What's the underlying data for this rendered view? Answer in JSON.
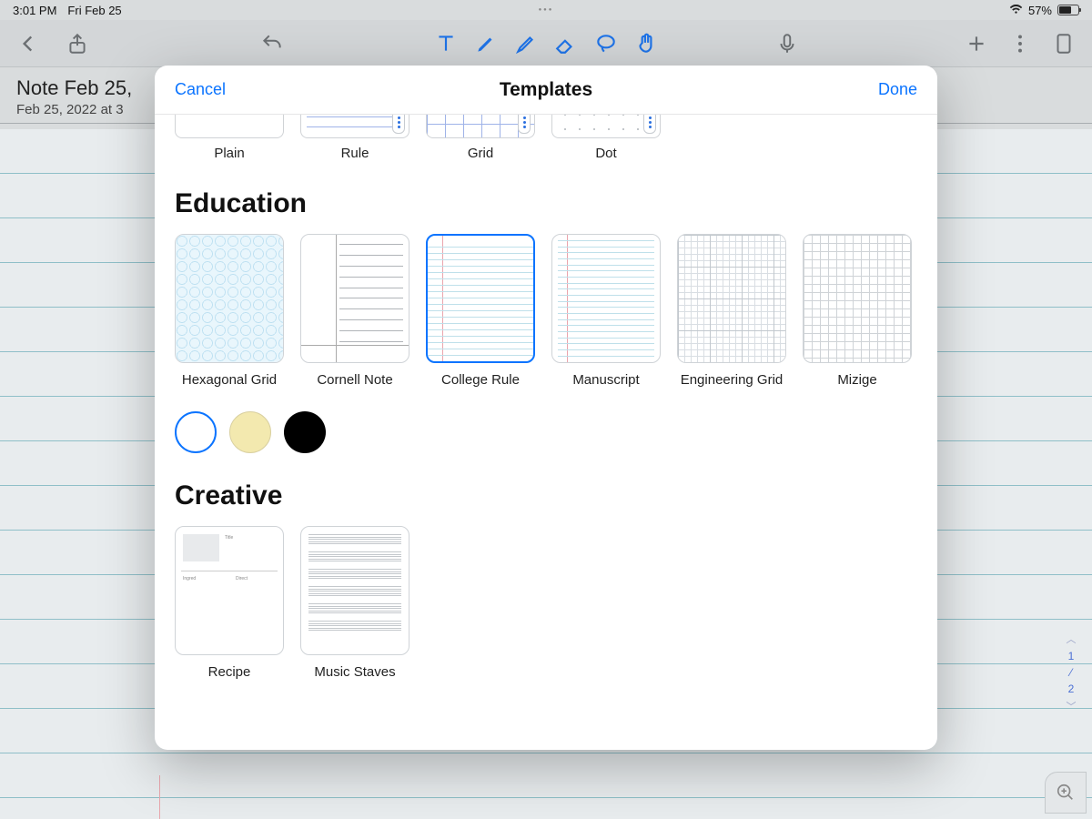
{
  "status": {
    "time": "3:01 PM",
    "date": "Fri Feb 25",
    "battery_pct": "57%"
  },
  "note": {
    "title_visible": "Note Feb 25,",
    "subtitle_visible": "Feb 25, 2022 at 3"
  },
  "modal": {
    "cancel": "Cancel",
    "title": "Templates",
    "done": "Done",
    "top_row": [
      {
        "id": "plain",
        "label": "Plain"
      },
      {
        "id": "rule",
        "label": "Rule"
      },
      {
        "id": "grid",
        "label": "Grid"
      },
      {
        "id": "dot",
        "label": "Dot"
      }
    ],
    "sections": {
      "education": {
        "title": "Education",
        "items": [
          {
            "id": "hexagonal-grid",
            "label": "Hexagonal Grid",
            "selected": false
          },
          {
            "id": "cornell-note",
            "label": "Cornell Note",
            "selected": false
          },
          {
            "id": "college-rule",
            "label": "College Rule",
            "selected": true
          },
          {
            "id": "manuscript",
            "label": "Manuscript",
            "selected": false
          },
          {
            "id": "engineering-grid",
            "label": "Engineering Grid",
            "selected": false
          },
          {
            "id": "mizige",
            "label": "Mizige",
            "selected": false
          }
        ],
        "colors": [
          {
            "id": "white",
            "hex": "#ffffff",
            "selected": true
          },
          {
            "id": "cream",
            "hex": "#f3e9af",
            "selected": false
          },
          {
            "id": "black",
            "hex": "#000000",
            "selected": false
          }
        ]
      },
      "creative": {
        "title": "Creative",
        "items": [
          {
            "id": "recipe",
            "label": "Recipe"
          },
          {
            "id": "music-staves",
            "label": "Music Staves"
          }
        ]
      }
    }
  },
  "page_nav": {
    "current": "1",
    "total": "2"
  }
}
